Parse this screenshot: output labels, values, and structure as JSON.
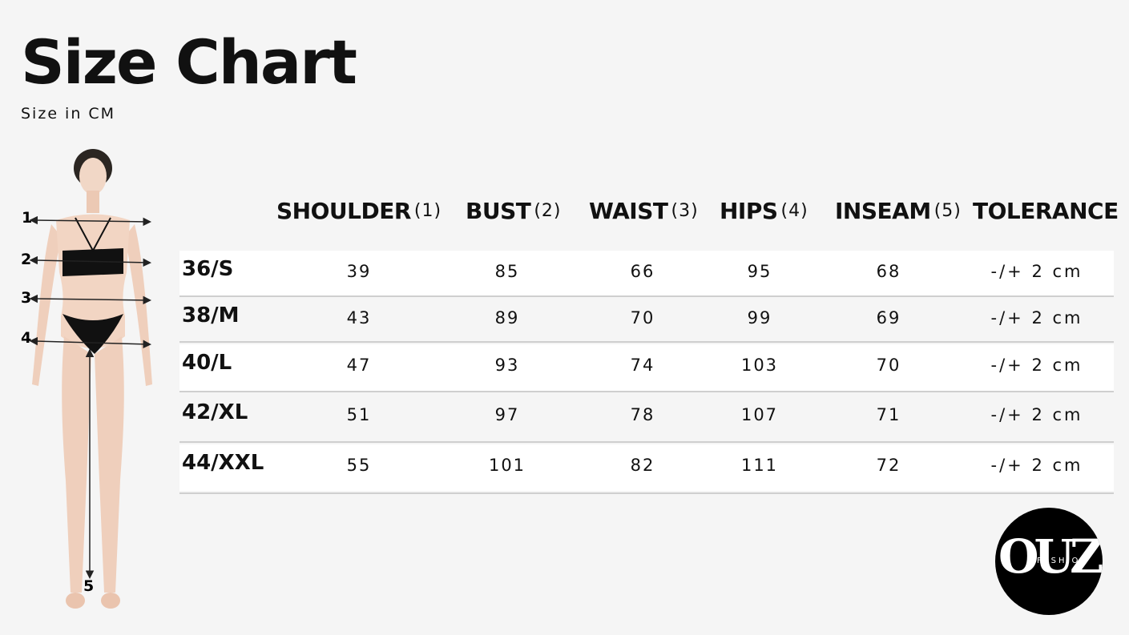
{
  "title": "Size Chart",
  "subtitle": "Size in CM",
  "figure_markers": [
    "1",
    "2",
    "3",
    "4",
    "5"
  ],
  "headers": [
    {
      "label": "SHOULDER",
      "num": "(1)"
    },
    {
      "label": "BUST",
      "num": "(2)"
    },
    {
      "label": "WAIST",
      "num": "(3)"
    },
    {
      "label": "HIPS",
      "num": "(4)"
    },
    {
      "label": "INSEAM",
      "num": "(5)"
    },
    {
      "label": "TOLERANCE",
      "num": ""
    }
  ],
  "rows": [
    {
      "size": "36/S",
      "values": [
        "39",
        "85",
        "66",
        "95",
        "68"
      ],
      "tolerance": "-/+ 2 cm"
    },
    {
      "size": "38/M",
      "values": [
        "43",
        "89",
        "70",
        "99",
        "69"
      ],
      "tolerance": "-/+ 2 cm"
    },
    {
      "size": "40/L",
      "values": [
        "47",
        "93",
        "74",
        "103",
        "70"
      ],
      "tolerance": "-/+ 2 cm"
    },
    {
      "size": "42/XL",
      "values": [
        "51",
        "97",
        "78",
        "107",
        "71"
      ],
      "tolerance": "-/+ 2 cm"
    },
    {
      "size": "44/XXL",
      "values": [
        "55",
        "101",
        "82",
        "111",
        "72"
      ],
      "tolerance": "-/+ 2 cm"
    }
  ],
  "logo": {
    "mark": "OUZ",
    "word": "FASHION"
  },
  "colors": {
    "background": "#f5f5f5",
    "row_alt": "#ffffff",
    "separator": "#cfcfcf",
    "logo": "#000000"
  }
}
